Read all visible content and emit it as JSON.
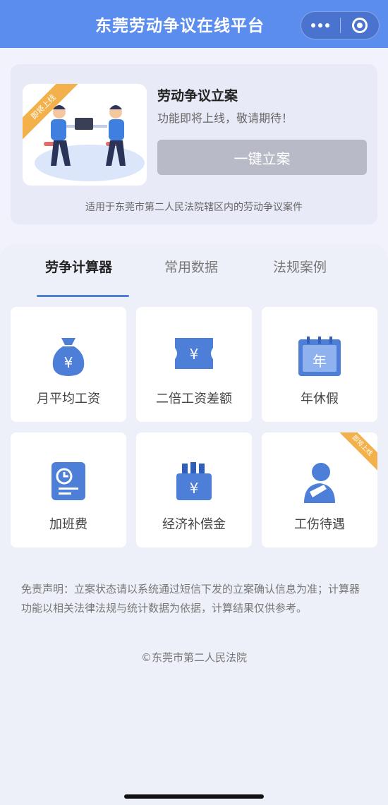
{
  "header": {
    "title": "东莞劳动争议在线平台"
  },
  "filing": {
    "ribbon": "即将上线",
    "title": "劳动争议立案",
    "subtitle": "功能即将上线，敬请期待！",
    "button_label": "一键立案",
    "note": "适用于东莞市第二人民法院辖区内的劳动争议案件"
  },
  "tabs": [
    {
      "label": "劳争计算器",
      "active": true
    },
    {
      "label": "常用数据",
      "active": false
    },
    {
      "label": "法规案例",
      "active": false
    }
  ],
  "tiles": [
    {
      "label": "月平均工资",
      "icon": "money-bag-icon"
    },
    {
      "label": "二倍工资差额",
      "icon": "ticket-yen-icon"
    },
    {
      "label": "年休假",
      "icon": "calendar-year-icon"
    },
    {
      "label": "加班费",
      "icon": "clock-document-icon"
    },
    {
      "label": "经济补偿金",
      "icon": "wallet-yen-icon"
    },
    {
      "label": "工伤待遇",
      "icon": "injured-person-icon",
      "badge": "即将上线"
    }
  ],
  "disclaimer": "免责声明：立案状态请以系统通过短信下发的立案确认信息为准；计算器功能以相关法律法规与统计数据为依据，计算结果仅供参考。",
  "copyright": "©东莞市第二人民法院",
  "colors": {
    "header": "#5b8def",
    "accent": "#4d7fd8",
    "ribbon": "#f2b14a",
    "button_disabled": "#b8bbc7"
  }
}
